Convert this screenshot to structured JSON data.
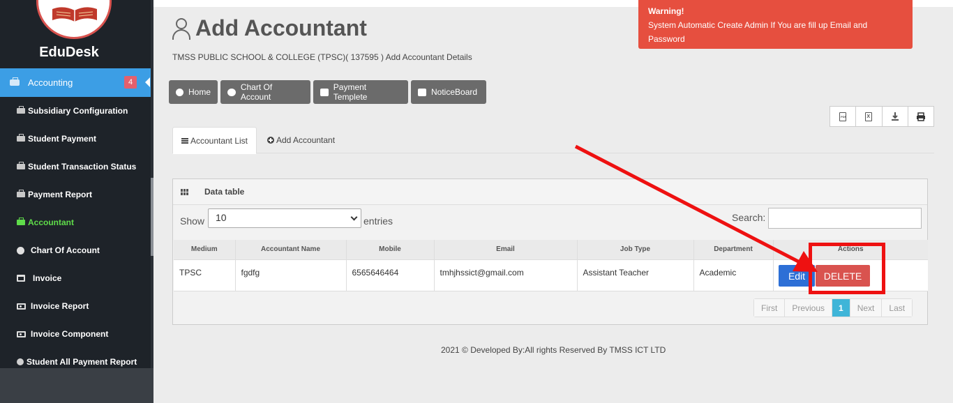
{
  "sidebar": {
    "brand": "EduDesk",
    "active": {
      "label": "Accounting",
      "badge": "4"
    },
    "items": [
      {
        "label": "Subsidiary Configuration"
      },
      {
        "label": "Student Payment"
      },
      {
        "label": "Student Transaction Status"
      },
      {
        "label": "Payment Report"
      },
      {
        "label": "Accountant"
      },
      {
        "label": "Chart Of Account"
      },
      {
        "label": "Invoice"
      },
      {
        "label": "Invoice Report"
      },
      {
        "label": "Invoice Component"
      },
      {
        "label": "Student All Payment Report"
      }
    ]
  },
  "header": {
    "title": "Add Accountant",
    "subtitle": "TMSS PUBLIC SCHOOL & COLLEGE (TPSC)( 137595 ) Add Accountant Details"
  },
  "warning": {
    "title": "Warning!",
    "message": "System Automatic Create Admin If You are fill up Email and Password"
  },
  "nav_buttons": {
    "home": "Home",
    "chart": "Chart Of Account",
    "payment": "Payment Templete",
    "notice": "NoticeBoard"
  },
  "export": {
    "pdf": "PDF",
    "excel": "X"
  },
  "tabs": {
    "list": "Accountant List",
    "add": "Add Accountant"
  },
  "panel": {
    "title": "Data table",
    "show_label": "Show",
    "page_size": "10",
    "entries_label": "entries",
    "search_label": "Search:"
  },
  "table": {
    "headers": [
      "Medium",
      "Accountant Name",
      "Mobile",
      "Email",
      "Job Type",
      "Department",
      "Actions"
    ],
    "rows": [
      [
        "TPSC",
        "fgdfg",
        "6565646464",
        "tmhjhssict@gmail.com",
        "Assistant Teacher",
        "Academic"
      ]
    ],
    "edit_label": "Edit",
    "delete_label": "DELETE"
  },
  "pager": {
    "first": "First",
    "previous": "Previous",
    "current": "1",
    "next": "Next",
    "last": "Last"
  },
  "footer": "2021 © Developed By:All rights Reserved By TMSS ICT LTD",
  "colors": {
    "accent": "#3c9ee5",
    "danger": "#d9534f",
    "annotation": "#ee1111"
  }
}
